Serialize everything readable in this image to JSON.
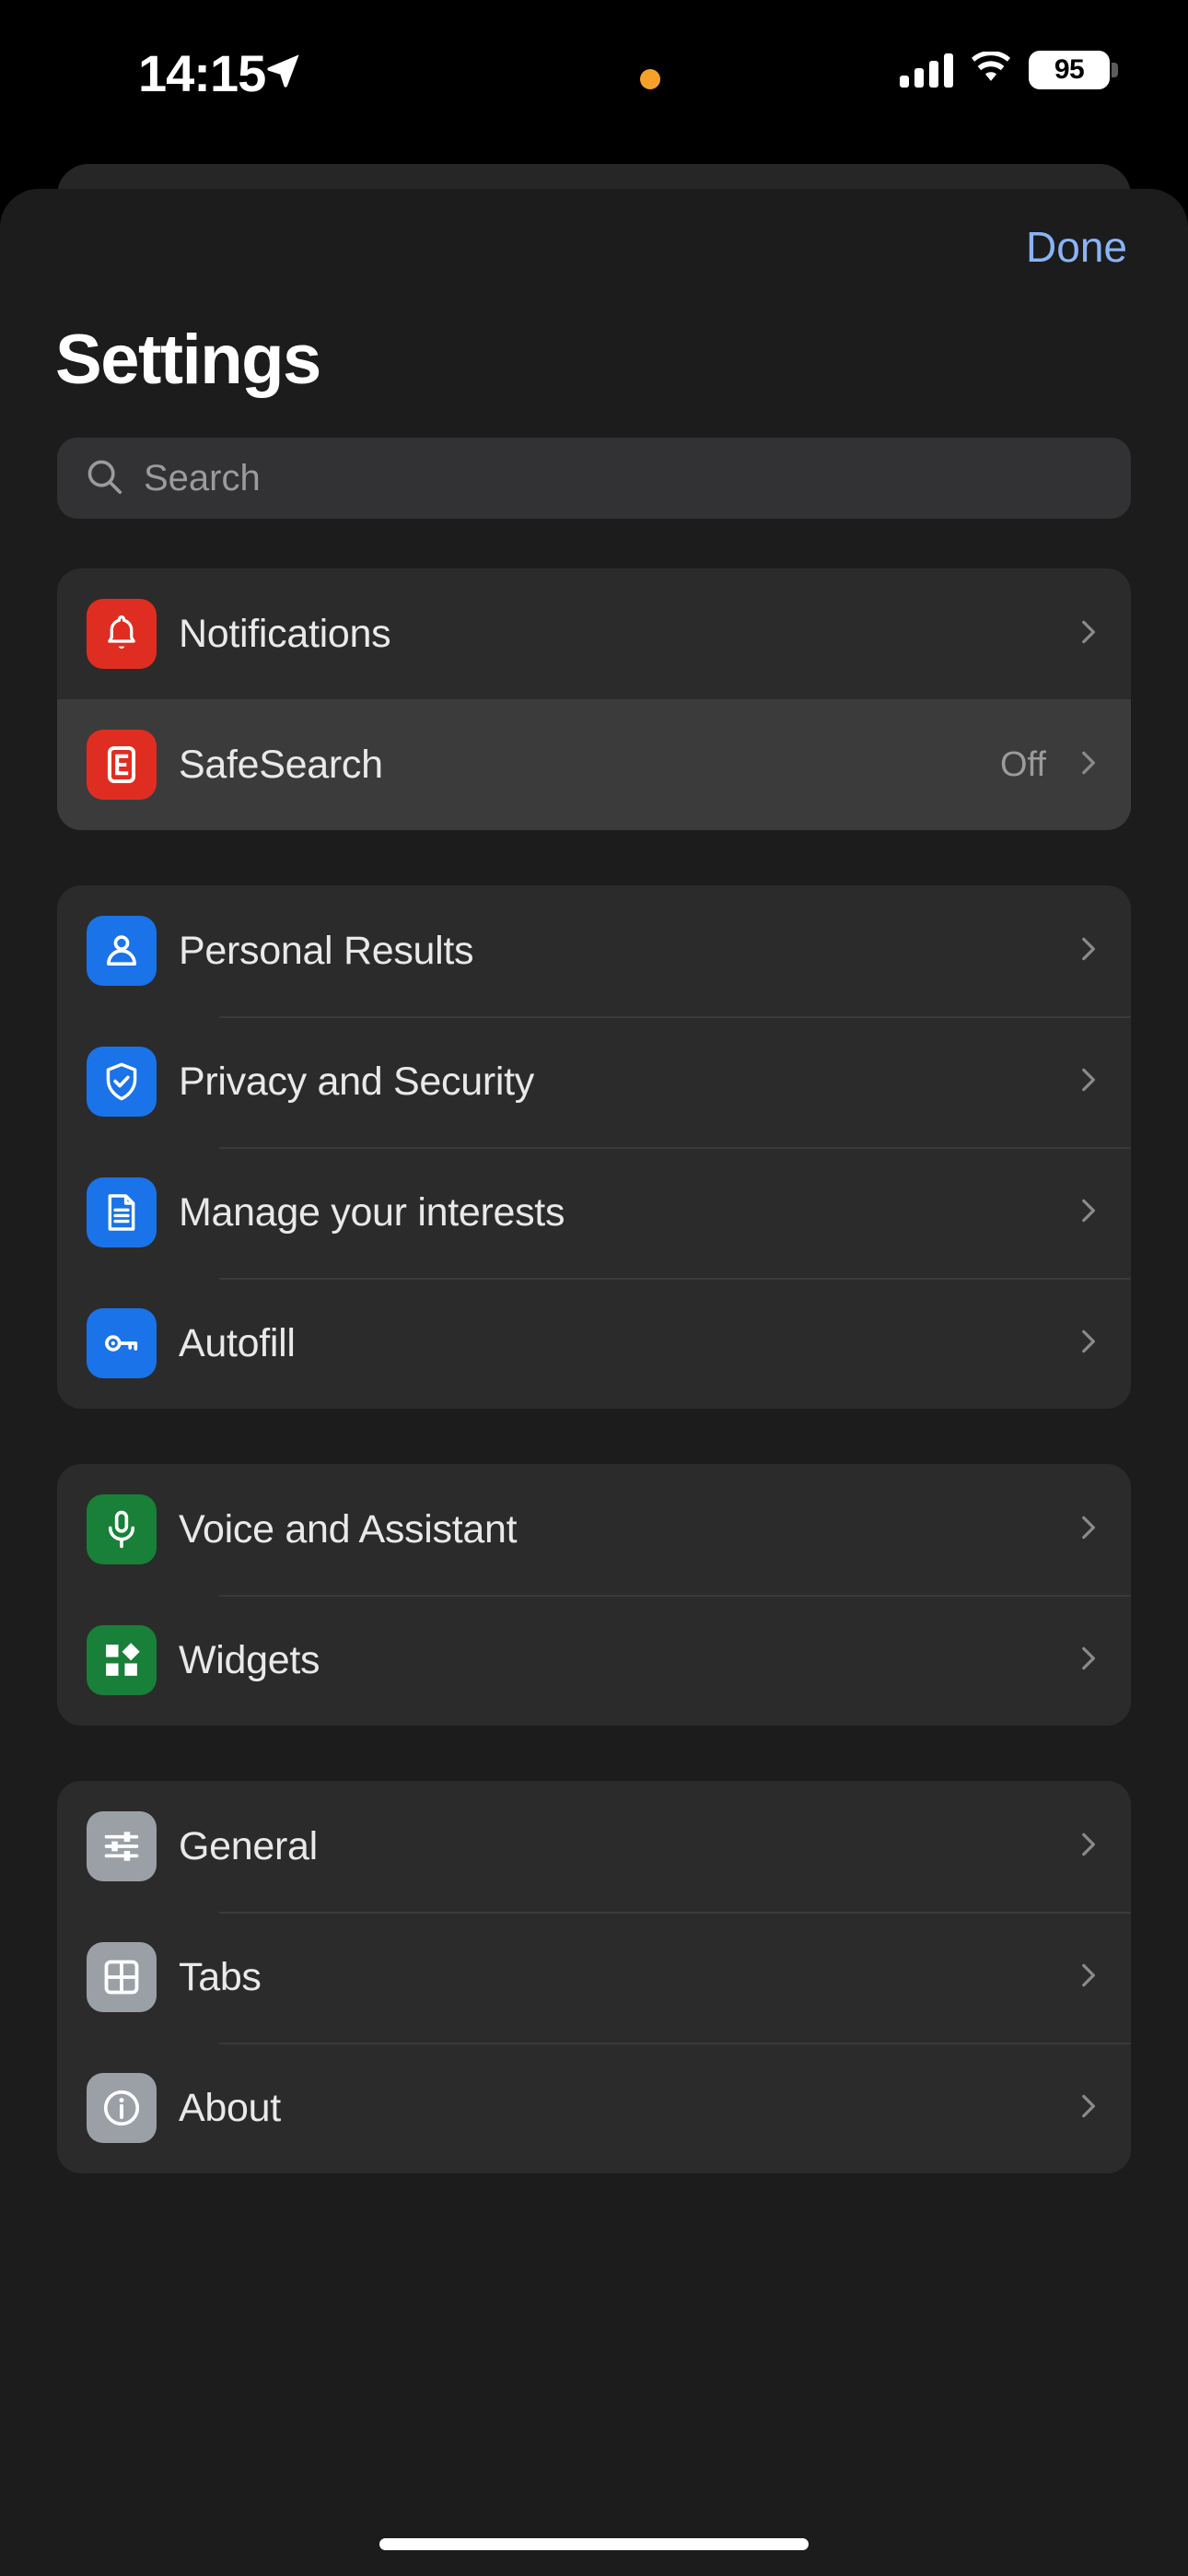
{
  "status_bar": {
    "time": "14:15",
    "location_icon": "location-arrow-icon",
    "privacy_indicator": "orange-privacy-dot",
    "cellular_icon": "cellular-signal-icon",
    "wifi_icon": "wifi-icon",
    "battery_percent": "95"
  },
  "nav": {
    "done_label": "Done"
  },
  "header": {
    "title": "Settings"
  },
  "search": {
    "placeholder": "Search",
    "value": "",
    "icon": "search-icon"
  },
  "colors": {
    "accent_blue": "#8ab4f8",
    "icon_red": "#e02d21",
    "icon_blue": "#1a73e8",
    "icon_green": "#188038",
    "icon_gray": "#9aa0a6",
    "sheet_bg": "#1c1c1c",
    "card_bg": "#2b2b2b",
    "row_highlight": "#3b3b3b",
    "label_text": "#e9e9ea",
    "secondary_text": "#9b9b9e",
    "privacy_dot": "#f6a22a"
  },
  "groups": [
    {
      "rows": [
        {
          "label": "Notifications",
          "icon": "bell-icon",
          "icon_color": "red",
          "value": "",
          "highlighted": false,
          "chevron": true
        },
        {
          "label": "SafeSearch",
          "icon": "rating-e-icon",
          "icon_color": "red",
          "value": "Off",
          "highlighted": true,
          "chevron": true
        }
      ]
    },
    {
      "rows": [
        {
          "label": "Personal Results",
          "icon": "person-icon",
          "icon_color": "blue",
          "value": "",
          "highlighted": false,
          "chevron": true
        },
        {
          "label": "Privacy and Security",
          "icon": "shield-check-icon",
          "icon_color": "blue",
          "value": "",
          "highlighted": false,
          "chevron": true
        },
        {
          "label": "Manage your interests",
          "icon": "document-icon",
          "icon_color": "blue",
          "value": "",
          "highlighted": false,
          "chevron": true
        },
        {
          "label": "Autofill",
          "icon": "key-icon",
          "icon_color": "blue",
          "value": "",
          "highlighted": false,
          "chevron": true
        }
      ]
    },
    {
      "rows": [
        {
          "label": "Voice and Assistant",
          "icon": "microphone-icon",
          "icon_color": "green",
          "value": "",
          "highlighted": false,
          "chevron": true
        },
        {
          "label": "Widgets",
          "icon": "widgets-icon",
          "icon_color": "green",
          "value": "",
          "highlighted": false,
          "chevron": true
        }
      ]
    },
    {
      "rows": [
        {
          "label": "General",
          "icon": "sliders-icon",
          "icon_color": "gray",
          "value": "",
          "highlighted": false,
          "chevron": true
        },
        {
          "label": "Tabs",
          "icon": "grid-icon",
          "icon_color": "gray",
          "value": "",
          "highlighted": false,
          "chevron": true
        },
        {
          "label": "About",
          "icon": "info-icon",
          "icon_color": "gray",
          "value": "",
          "highlighted": false,
          "chevron": true
        }
      ]
    }
  ],
  "home_indicator": "home-indicator-bar"
}
